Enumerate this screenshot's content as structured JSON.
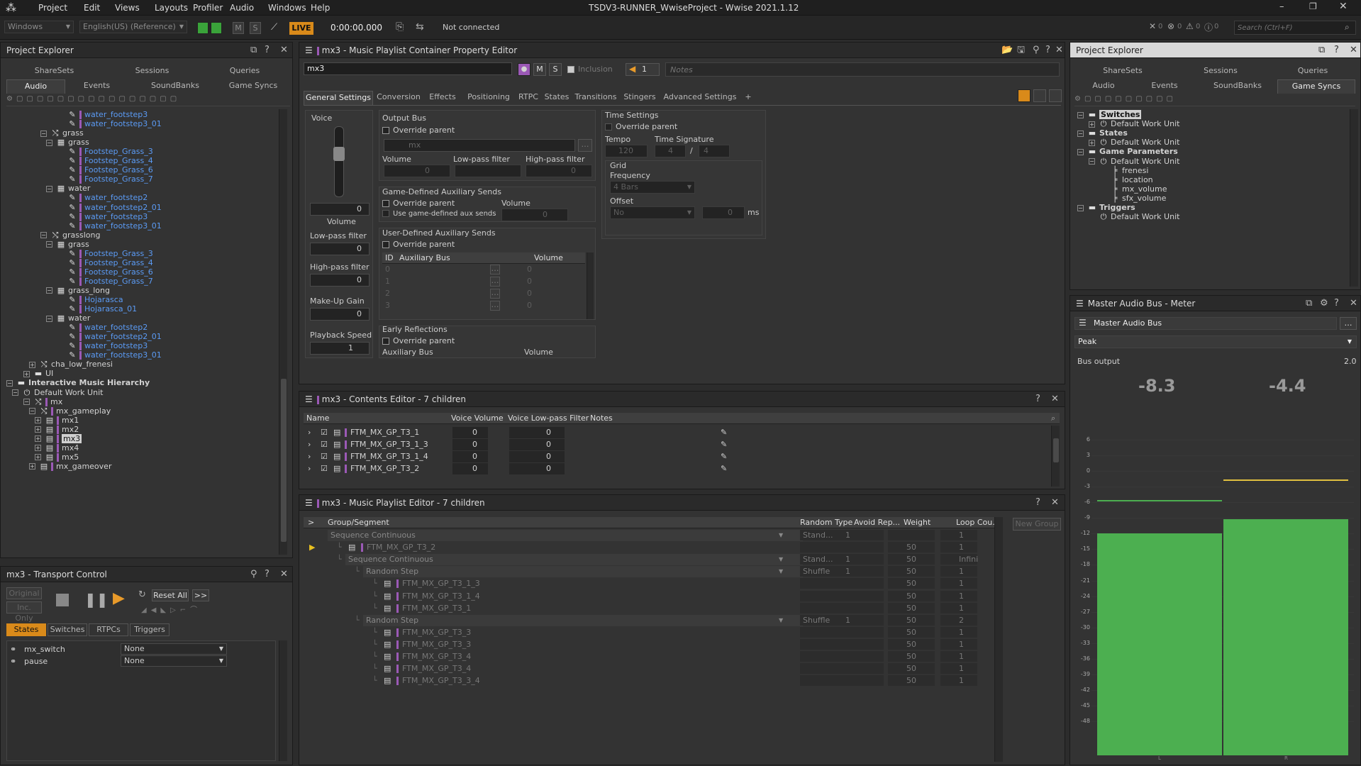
{
  "app": {
    "title": "TSDV3-RUNNER_WwiseProject - Wwise 2021.1.12",
    "menu": [
      "Project",
      "Edit",
      "Views",
      "Layouts",
      "Profiler",
      "Audio",
      "Windows",
      "Help"
    ]
  },
  "toolbar": {
    "platform": "Windows",
    "language": "English(US) (Reference)",
    "m_label": "M",
    "s_label": "S",
    "live_label": "LIVE",
    "time": "0:00:00.000",
    "status": "Not connected",
    "search_placeholder": "Search (Ctrl+F)",
    "counts": [
      "0",
      "0",
      "0",
      "0"
    ]
  },
  "left_explorer": {
    "title": "Project Explorer",
    "tabs_top": [
      "ShareSets",
      "Sessions",
      "Queries"
    ],
    "tabs_bottom": [
      "Audio",
      "Events",
      "SoundBanks",
      "Game Syncs"
    ],
    "active_tab": "Audio",
    "tree": [
      {
        "label": "water_footstep3",
        "indent": 9,
        "blue": true,
        "icon": "sound"
      },
      {
        "label": "water_footstep3_01",
        "indent": 9,
        "blue": true,
        "icon": "sound"
      },
      {
        "label": "grass",
        "indent": 6,
        "blue": false,
        "icon": "switch",
        "exp": "−"
      },
      {
        "label": "grass",
        "indent": 7,
        "blue": false,
        "icon": "random",
        "exp": "−"
      },
      {
        "label": "Footstep_Grass_3",
        "indent": 9,
        "blue": true,
        "icon": "sound"
      },
      {
        "label": "Footstep_Grass_4",
        "indent": 9,
        "blue": true,
        "icon": "sound"
      },
      {
        "label": "Footstep_Grass_6",
        "indent": 9,
        "blue": true,
        "icon": "sound"
      },
      {
        "label": "Footstep_Grass_7",
        "indent": 9,
        "blue": true,
        "icon": "sound"
      },
      {
        "label": "water",
        "indent": 7,
        "blue": false,
        "icon": "random",
        "exp": "−"
      },
      {
        "label": "water_footstep2",
        "indent": 9,
        "blue": true,
        "icon": "sound"
      },
      {
        "label": "water_footstep2_01",
        "indent": 9,
        "blue": true,
        "icon": "sound"
      },
      {
        "label": "water_footstep3",
        "indent": 9,
        "blue": true,
        "icon": "sound"
      },
      {
        "label": "water_footstep3_01",
        "indent": 9,
        "blue": true,
        "icon": "sound"
      },
      {
        "label": "grasslong",
        "indent": 6,
        "blue": false,
        "icon": "switch",
        "exp": "−"
      },
      {
        "label": "grass",
        "indent": 7,
        "blue": false,
        "icon": "random",
        "exp": "−"
      },
      {
        "label": "Footstep_Grass_3",
        "indent": 9,
        "blue": true,
        "icon": "sound"
      },
      {
        "label": "Footstep_Grass_4",
        "indent": 9,
        "blue": true,
        "icon": "sound"
      },
      {
        "label": "Footstep_Grass_6",
        "indent": 9,
        "blue": true,
        "icon": "sound"
      },
      {
        "label": "Footstep_Grass_7",
        "indent": 9,
        "blue": true,
        "icon": "sound"
      },
      {
        "label": "grass_long",
        "indent": 7,
        "blue": false,
        "icon": "random",
        "exp": "−"
      },
      {
        "label": "Hojarasca",
        "indent": 9,
        "blue": true,
        "icon": "sound"
      },
      {
        "label": "Hojarasca_01",
        "indent": 9,
        "blue": true,
        "icon": "sound"
      },
      {
        "label": "water",
        "indent": 7,
        "blue": false,
        "icon": "random",
        "exp": "−"
      },
      {
        "label": "water_footstep2",
        "indent": 9,
        "blue": true,
        "icon": "sound"
      },
      {
        "label": "water_footstep2_01",
        "indent": 9,
        "blue": true,
        "icon": "sound"
      },
      {
        "label": "water_footstep3",
        "indent": 9,
        "blue": true,
        "icon": "sound"
      },
      {
        "label": "water_footstep3_01",
        "indent": 9,
        "blue": true,
        "icon": "sound"
      },
      {
        "label": "cha_low_frenesi",
        "indent": 4,
        "blue": false,
        "icon": "switch",
        "exp": "+"
      },
      {
        "label": "UI",
        "indent": 3,
        "blue": false,
        "icon": "folder",
        "exp": "+"
      },
      {
        "label": "Interactive Music Hierarchy",
        "indent": 0,
        "blue": false,
        "icon": "folder",
        "exp": "−",
        "bold": true
      },
      {
        "label": "Default Work Unit",
        "indent": 1,
        "blue": false,
        "icon": "wu",
        "exp": "−"
      },
      {
        "label": "mx",
        "indent": 3,
        "blue": false,
        "icon": "mswitch",
        "exp": "−"
      },
      {
        "label": "mx_gameplay",
        "indent": 4,
        "blue": false,
        "icon": "mswitch",
        "exp": "−"
      },
      {
        "label": "mx1",
        "indent": 5,
        "blue": false,
        "icon": "playlist",
        "exp": "+"
      },
      {
        "label": "mx2",
        "indent": 5,
        "blue": false,
        "icon": "playlist",
        "exp": "+"
      },
      {
        "label": "mx3",
        "indent": 5,
        "blue": false,
        "icon": "playlist",
        "exp": "+",
        "selected": true
      },
      {
        "label": "mx4",
        "indent": 5,
        "blue": false,
        "icon": "playlist",
        "exp": "+"
      },
      {
        "label": "mx5",
        "indent": 5,
        "blue": false,
        "icon": "playlist",
        "exp": "+"
      },
      {
        "label": "mx_gameover",
        "indent": 4,
        "blue": false,
        "icon": "playlist",
        "exp": "+"
      }
    ]
  },
  "transport": {
    "title": "mx3 - Transport Control",
    "original": "Original",
    "inc_only": "Inc. Only",
    "reset_all": "Reset All",
    "more": ">>",
    "tabs": [
      "States",
      "Switches",
      "RTPCs",
      "Triggers"
    ],
    "rows": [
      {
        "name": "mx_switch",
        "value": "None"
      },
      {
        "name": "pause",
        "value": "None"
      }
    ]
  },
  "prop_editor": {
    "title": "mx3 - Music Playlist Container Property Editor",
    "name": "mx3",
    "inclusion": "Inclusion",
    "color_count": "1",
    "notes_placeholder": "Notes",
    "tabs": [
      "General Settings",
      "Conversion",
      "Effects",
      "Positioning",
      "RTPC",
      "States",
      "Transitions",
      "Stingers",
      "Advanced Settings",
      "+"
    ],
    "voice": {
      "title": "Voice",
      "volume_label": "Volume",
      "volume": "0",
      "lowpass_label": "Low-pass filter",
      "lowpass": "0",
      "highpass_label": "High-pass filter",
      "highpass": "0",
      "makeup_label": "Make-Up Gain",
      "makeup": "0",
      "speed_label": "Playback Speed",
      "speed": "1"
    },
    "output_bus": {
      "title": "Output Bus",
      "override": "Override parent",
      "bus": "mx",
      "volume_label": "Volume",
      "lowpass_label": "Low-pass filter",
      "highpass_label": "High-pass filter",
      "volume": "0",
      "lowpass": "0",
      "highpass": "0"
    },
    "game_aux": {
      "title": "Game-Defined Auxiliary Sends",
      "override": "Override parent",
      "use": "Use game-defined aux sends",
      "volume_label": "Volume",
      "volume": "0"
    },
    "user_aux": {
      "title": "User-Defined Auxiliary Sends",
      "override": "Override parent",
      "cols": [
        "ID",
        "Auxiliary Bus",
        "Volume"
      ],
      "ids": [
        "0",
        "1",
        "2",
        "3"
      ],
      "vals": [
        "0",
        "0",
        "0",
        "0"
      ]
    },
    "early": {
      "title": "Early Reflections",
      "override": "Override parent",
      "bus_label": "Auxiliary Bus",
      "volume_label": "Volume"
    },
    "time": {
      "title": "Time Settings",
      "override": "Override parent",
      "tempo_label": "Tempo",
      "tempo": "120",
      "sig_label": "Time Signature",
      "sig_a": "4",
      "sig_b": "4",
      "grid_label": "Grid",
      "freq_label": "Frequency",
      "freq": "4 Bars",
      "offset_label": "Offset",
      "offset": "No",
      "offset_val": "0",
      "ms": "ms"
    }
  },
  "contents": {
    "title": "mx3 - Contents Editor - 7 children",
    "cols": [
      "Name",
      "Voice Volume",
      "Voice Low-pass Filter",
      "Notes"
    ],
    "rows": [
      {
        "name": "FTM_MX_GP_T3_1",
        "vol": "0",
        "lpf": "0"
      },
      {
        "name": "FTM_MX_GP_T3_1_3",
        "vol": "0",
        "lpf": "0"
      },
      {
        "name": "FTM_MX_GP_T3_1_4",
        "vol": "0",
        "lpf": "0"
      },
      {
        "name": "FTM_MX_GP_T3_2",
        "vol": "0",
        "lpf": "0"
      }
    ]
  },
  "playlist": {
    "title": "mx3 - Music Playlist Editor - 7 children",
    "new_group": "New Group",
    "cols": [
      ">",
      "Group/Segment",
      "Random Type",
      "Avoid Rep...",
      "Weight",
      "Loop Cou..."
    ],
    "rows": [
      {
        "label": "Sequence Continuous",
        "indent": 0,
        "type": "group",
        "rtype": "Stand...",
        "avoid": "1",
        "weight": "",
        "loop": "1"
      },
      {
        "label": "FTM_MX_GP_T3_2",
        "indent": 1,
        "type": "seg",
        "rtype": "",
        "avoid": "",
        "weight": "50",
        "loop": "1",
        "play": true
      },
      {
        "label": "Sequence Continuous",
        "indent": 1,
        "type": "group",
        "rtype": "Stand...",
        "avoid": "1",
        "weight": "50",
        "loop": "Infini"
      },
      {
        "label": "Random Step",
        "indent": 2,
        "type": "group",
        "rtype": "Shuffle",
        "avoid": "1",
        "weight": "50",
        "loop": "1"
      },
      {
        "label": "FTM_MX_GP_T3_1_3",
        "indent": 3,
        "type": "seg",
        "rtype": "",
        "avoid": "",
        "weight": "50",
        "loop": "1"
      },
      {
        "label": "FTM_MX_GP_T3_1_4",
        "indent": 3,
        "type": "seg",
        "rtype": "",
        "avoid": "",
        "weight": "50",
        "loop": "1"
      },
      {
        "label": "FTM_MX_GP_T3_1",
        "indent": 3,
        "type": "seg",
        "rtype": "",
        "avoid": "",
        "weight": "50",
        "loop": "1"
      },
      {
        "label": "Random Step",
        "indent": 2,
        "type": "group",
        "rtype": "Shuffle",
        "avoid": "1",
        "weight": "50",
        "loop": "2"
      },
      {
        "label": "FTM_MX_GP_T3_3",
        "indent": 3,
        "type": "seg",
        "rtype": "",
        "avoid": "",
        "weight": "50",
        "loop": "1"
      },
      {
        "label": "FTM_MX_GP_T3_3",
        "indent": 3,
        "type": "seg",
        "rtype": "",
        "avoid": "",
        "weight": "50",
        "loop": "1"
      },
      {
        "label": "FTM_MX_GP_T3_4",
        "indent": 3,
        "type": "seg",
        "rtype": "",
        "avoid": "",
        "weight": "50",
        "loop": "1"
      },
      {
        "label": "FTM_MX_GP_T3_4",
        "indent": 3,
        "type": "seg",
        "rtype": "",
        "avoid": "",
        "weight": "50",
        "loop": "1"
      },
      {
        "label": "FTM_MX_GP_T3_3_4",
        "indent": 3,
        "type": "seg",
        "rtype": "",
        "avoid": "",
        "weight": "50",
        "loop": "1"
      }
    ]
  },
  "right_explorer": {
    "title": "Project Explorer",
    "tabs_top": [
      "ShareSets",
      "Sessions",
      "Queries"
    ],
    "tabs_bottom": [
      "Audio",
      "Events",
      "SoundBanks",
      "Game Syncs"
    ],
    "active_tab": "Game Syncs",
    "tree": [
      {
        "label": "Switches",
        "indent": 0,
        "icon": "folder",
        "exp": "−",
        "bold": true,
        "selected": true
      },
      {
        "label": "Default Work Unit",
        "indent": 1,
        "icon": "wu",
        "exp": "+"
      },
      {
        "label": "States",
        "indent": 0,
        "icon": "folder",
        "exp": "−",
        "bold": true
      },
      {
        "label": "Default Work Unit",
        "indent": 1,
        "icon": "wu",
        "exp": "+"
      },
      {
        "label": "Game Parameters",
        "indent": 0,
        "icon": "folder",
        "exp": "−",
        "bold": true
      },
      {
        "label": "Default Work Unit",
        "indent": 1,
        "icon": "wu",
        "exp": "−"
      },
      {
        "label": "frenesi",
        "indent": 2,
        "icon": "param"
      },
      {
        "label": "location",
        "indent": 2,
        "icon": "param"
      },
      {
        "label": "mx_volume",
        "indent": 2,
        "icon": "param"
      },
      {
        "label": "sfx_volume",
        "indent": 2,
        "icon": "param"
      },
      {
        "label": "Triggers",
        "indent": 0,
        "icon": "folder",
        "exp": "−",
        "bold": true
      },
      {
        "label": "Default Work Unit",
        "indent": 1,
        "icon": "wu"
      }
    ]
  },
  "meter": {
    "title": "Master Audio Bus - Meter",
    "bus": "Master Audio Bus",
    "mode": "Peak",
    "output_label": "Bus output",
    "output_val": "2.0",
    "left_peak": "-8.3",
    "right_peak": "-4.4",
    "scale": [
      "6",
      "3",
      "0",
      "-3",
      "-6",
      "-9",
      "-12",
      "-15",
      "-18",
      "-21",
      "-24",
      "-27",
      "-30",
      "-33",
      "-36",
      "-39",
      "-42",
      "-45",
      "-48"
    ],
    "channels": [
      "L",
      "R"
    ],
    "level_l": -12.0,
    "level_r": -9.2,
    "hold_l": -8.3,
    "hold_r": -4.4,
    "colors": {
      "bar": "#4caf50",
      "hold_l": "#4caf50",
      "hold_r": "#e0c040"
    }
  }
}
